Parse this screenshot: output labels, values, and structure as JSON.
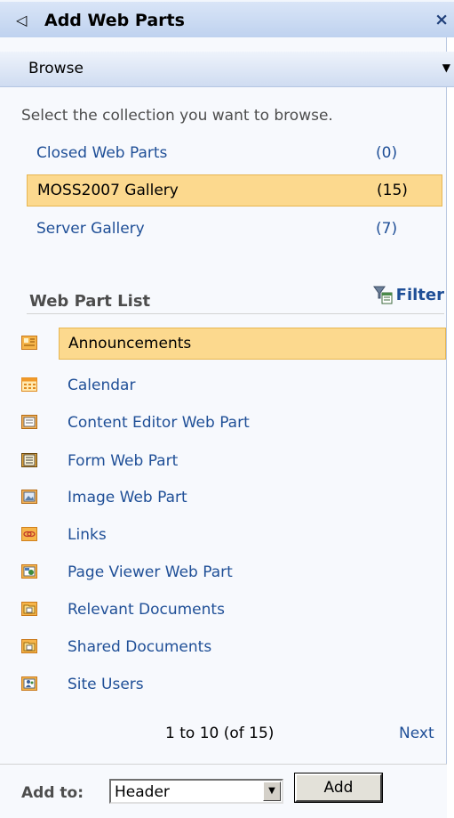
{
  "panel": {
    "title": "Add Web Parts",
    "back_icon": "◁",
    "close_icon": "×"
  },
  "menu": {
    "label": "Browse"
  },
  "collections": {
    "prompt": "Select the collection you want to browse.",
    "items": [
      {
        "name": "Closed Web Parts",
        "count": "(0)"
      },
      {
        "name": "MOSS2007 Gallery",
        "count": "(15)"
      },
      {
        "name": "Server Gallery",
        "count": "(7)"
      }
    ]
  },
  "web_part_list": {
    "heading": "Web Part List",
    "filter_label": "Filter",
    "items": [
      {
        "label": "Announcements",
        "icon": "announcements-icon"
      },
      {
        "label": "Calendar",
        "icon": "calendar-icon"
      },
      {
        "label": "Content Editor Web Part",
        "icon": "content-editor-icon"
      },
      {
        "label": "Form Web Part",
        "icon": "form-icon"
      },
      {
        "label": "Image Web Part",
        "icon": "image-icon"
      },
      {
        "label": "Links",
        "icon": "links-icon"
      },
      {
        "label": "Page Viewer Web Part",
        "icon": "page-viewer-icon"
      },
      {
        "label": "Relevant Documents",
        "icon": "documents-icon"
      },
      {
        "label": "Shared Documents",
        "icon": "documents-icon"
      },
      {
        "label": "Site Users",
        "icon": "users-icon"
      }
    ],
    "pager_range": "1 to 10 (of 15)",
    "pager_next": "Next"
  },
  "footer": {
    "add_to_label": "Add to:",
    "zone_value": "Header",
    "add_button": "Add"
  },
  "colors": {
    "selected_bg": "#fcd98e",
    "link": "#1f4f97",
    "header_gradient": "#bfd2ef"
  }
}
